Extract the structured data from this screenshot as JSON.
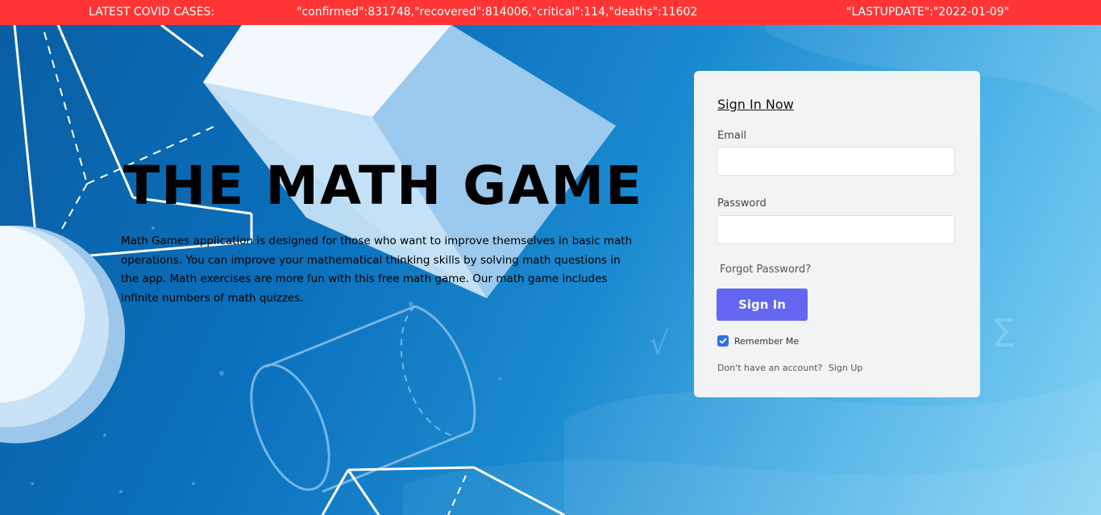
{
  "banner": {
    "label": "LATEST COVID CASES:",
    "stats": "\"confirmed\":831748,\"recovered\":814006,\"critical\":114,\"deaths\":11602",
    "last_update": "\"LASTUPDATE\":\"2022-01-09\"",
    "color": "#ff3535"
  },
  "hero": {
    "title": "THE MATH GAME",
    "description": "Math Games application is designed for those who want to improve themselves in basic math operations. You can improve your mathematical thinking skills by solving math questions in the app. Math exercises are more fun with this free math game. Our math game includes infinite numbers of math quizzes."
  },
  "signin": {
    "title": "Sign In Now",
    "email_label": "Email",
    "email_value": "",
    "password_label": "Password",
    "password_value": "",
    "forgot_label": "Forgot Password?",
    "button_label": "Sign In",
    "remember_label": "Remember Me",
    "remember_checked": true,
    "no_account_text": "Don't have an account?",
    "signup_label": "Sign Up",
    "accent_color": "#6366f1"
  },
  "icons": {
    "checkbox": "check-icon"
  }
}
